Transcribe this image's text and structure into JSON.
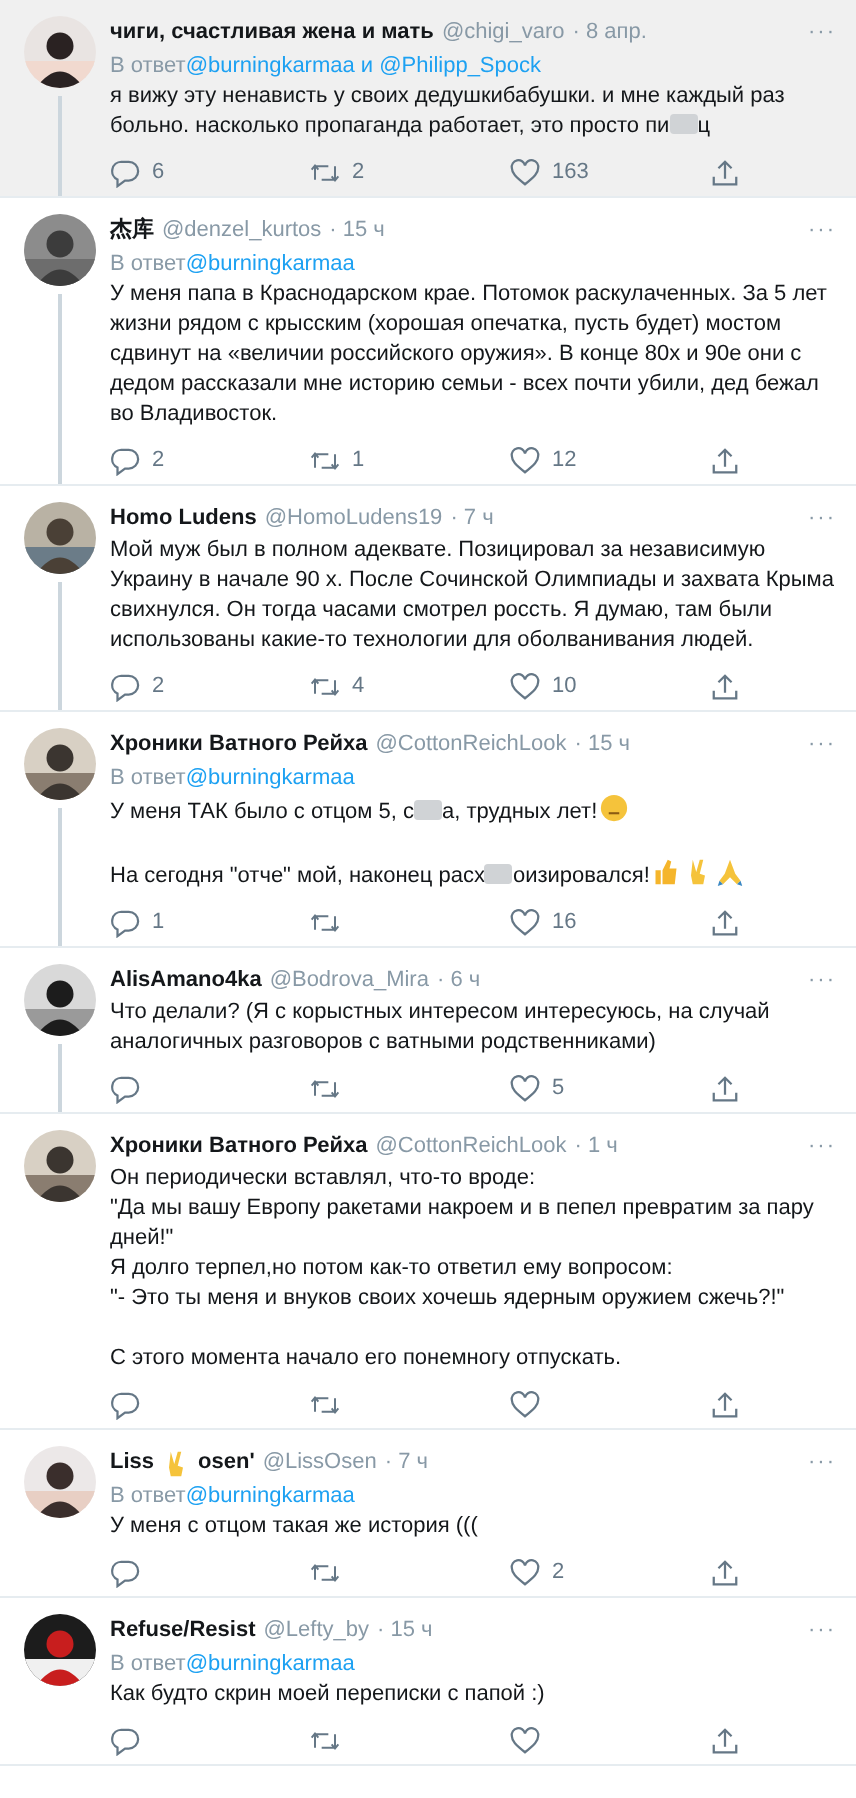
{
  "tweets": [
    {
      "highlighted": true,
      "thread_line": true,
      "name": [
        {
          "kind": "text",
          "text": "чиги, счастливая жена и мать"
        }
      ],
      "handle": "@chigi_varo",
      "time": "· 8 апр.",
      "more": "···",
      "reply": {
        "prefix": "В ответ",
        "to": "@burningkarmaa и @Philipp_Spock"
      },
      "body": [
        [
          [
            {
              "kind": "text",
              "text": "я вижу эту ненависть у своих дедушкибабушки. и мне каждый раз больно. насколько пропаганда работает, это просто пи"
            },
            {
              "kind": "censor"
            },
            {
              "kind": "text",
              "text": "ц"
            }
          ]
        ]
      ],
      "stats": {
        "replies": "6",
        "retweets": "2",
        "likes": "163"
      }
    },
    {
      "highlighted": false,
      "thread_line": true,
      "name": [
        {
          "kind": "text",
          "text": "杰库"
        }
      ],
      "handle": "@denzel_kurtos",
      "time": "· 15 ч",
      "more": "···",
      "reply": {
        "prefix": "В ответ",
        "to": "@burningkarmaa"
      },
      "body": [
        [
          [
            {
              "kind": "text",
              "text": "У меня папа в Краснодарском крае. Потомок раскулаченных. За 5 лет жизни рядом с крысским (хорошая опечатка, пусть будет) мостом сдвинут на «величии российского оружия». В конце 80х и 90е они с дедом рассказали мне историю семьи - всех почти убили, дед бежал во Владивосток."
            }
          ]
        ]
      ],
      "stats": {
        "replies": "2",
        "retweets": "1",
        "likes": "12"
      }
    },
    {
      "highlighted": false,
      "thread_line": true,
      "name": [
        {
          "kind": "text",
          "text": "Homo Ludens"
        }
      ],
      "handle": "@HomoLudens19",
      "time": "· 7 ч",
      "more": "···",
      "body": [
        [
          [
            {
              "kind": "text",
              "text": "Мой муж был в полном адеквате. Позицировал за независимую Украину в начале 90 х. После Сочинской Олимпиады и захвата Крыма свихнулся. Он тогда часами смотрел россть. Я думаю, там были использованы какие-то технологии для оболванивания людей."
            }
          ]
        ]
      ],
      "stats": {
        "replies": "2",
        "retweets": "4",
        "likes": "10"
      }
    },
    {
      "highlighted": false,
      "thread_line": true,
      "name": [
        {
          "kind": "text",
          "text": "Хроники Ватного Рейха"
        }
      ],
      "handle": "@CottonReichLook",
      "time": "· 15 ч",
      "more": "···",
      "reply": {
        "prefix": "В ответ",
        "to": "@burningkarmaa"
      },
      "body": [
        [
          [
            {
              "kind": "text",
              "text": "У меня ТАК было с отцом 5, с"
            },
            {
              "kind": "censor"
            },
            {
              "kind": "text",
              "text": "а, трудных лет!"
            },
            {
              "kind": "face-emoji"
            }
          ]
        ],
        [
          [
            {
              "kind": "text",
              "text": "На сегодня \"отче\" мой, наконец расх"
            },
            {
              "kind": "censor"
            },
            {
              "kind": "text",
              "text": "оизировался!"
            },
            {
              "kind": "thumbs-emoji"
            },
            {
              "kind": "victory-emoji"
            },
            {
              "kind": "pray-emoji"
            }
          ]
        ]
      ],
      "stats": {
        "replies": "1",
        "likes": "16"
      }
    },
    {
      "highlighted": false,
      "thread_line": true,
      "name": [
        {
          "kind": "text",
          "text": "AlisAmano4ka"
        }
      ],
      "handle": "@Bodrova_Mira",
      "time": "· 6 ч",
      "more": "···",
      "body": [
        [
          [
            {
              "kind": "text",
              "text": "Что делали? (Я с корыстных интересом интересуюсь, на случай аналогичных разговоров с ватными родственниками)"
            }
          ]
        ]
      ],
      "stats": {
        "likes": "5"
      }
    },
    {
      "highlighted": false,
      "thread_line": false,
      "name": [
        {
          "kind": "text",
          "text": "Хроники Ватного Рейха"
        }
      ],
      "handle": "@CottonReichLook",
      "time": "· 1 ч",
      "more": "···",
      "body": [
        [
          [
            {
              "kind": "text",
              "text": "Он периодически вставлял, что-то вроде:"
            }
          ],
          [
            {
              "kind": "text",
              "text": "\"Да мы вашу Европу ракетами накроем и в пепел превратим за пару дней!\""
            }
          ],
          [
            {
              "kind": "text",
              "text": "Я долго терпел,но потом как-то ответил ему вопросом:"
            }
          ],
          [
            {
              "kind": "text",
              "text": "\"- Это ты меня и внуков своих хочешь ядерным оружием сжечь?!\""
            }
          ]
        ],
        [
          [
            {
              "kind": "text",
              "text": "С этого момента начало его понемногу отпускать."
            }
          ]
        ]
      ]
    },
    {
      "highlighted": false,
      "thread_line": false,
      "name": [
        {
          "kind": "text",
          "text": "Liss"
        },
        {
          "kind": "victory-emoji"
        },
        {
          "kind": "text",
          "text": "osen'"
        }
      ],
      "handle": "@LissOsen",
      "time": "· 7 ч",
      "more": "···",
      "reply": {
        "prefix": "В ответ",
        "to": "@burningkarmaa"
      },
      "body": [
        [
          [
            {
              "kind": "text",
              "text": "У меня с отцом такая же история ((("
            }
          ]
        ]
      ],
      "stats": {
        "likes": "2"
      }
    },
    {
      "highlighted": false,
      "thread_line": false,
      "name": [
        {
          "kind": "text",
          "text": "Refuse/Resist"
        }
      ],
      "handle": "@Lefty_by",
      "time": "· 15 ч",
      "more": "···",
      "reply": {
        "prefix": "В ответ",
        "to": "@burningkarmaa"
      },
      "body": [
        [
          [
            {
              "kind": "text",
              "text": "Как будто скрин моей переписки с папой :)"
            }
          ]
        ]
      ]
    }
  ]
}
